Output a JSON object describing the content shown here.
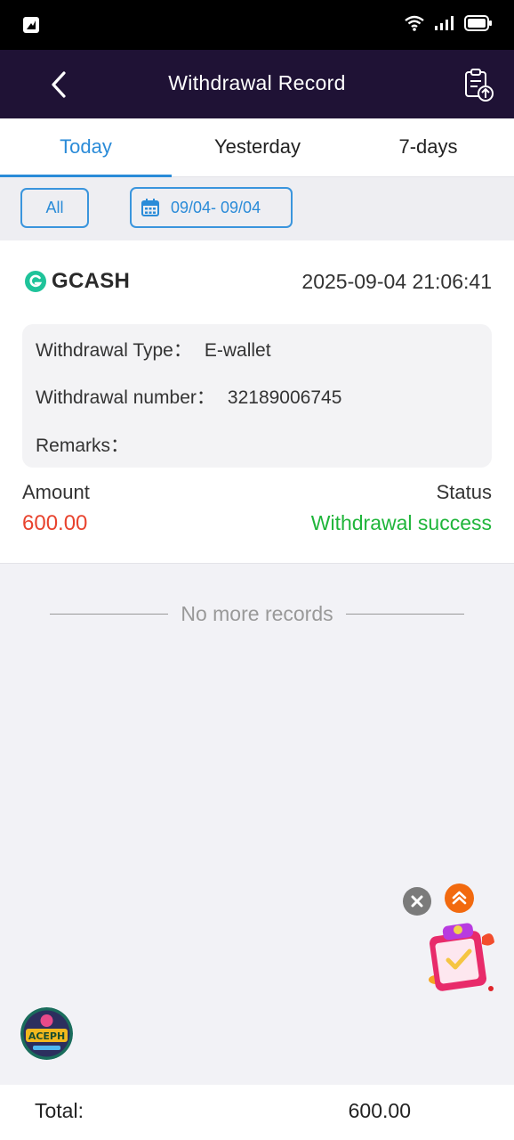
{
  "header": {
    "title": "Withdrawal Record"
  },
  "tabs": [
    {
      "label": "Today",
      "active": true
    },
    {
      "label": "Yesterday",
      "active": false
    },
    {
      "label": "7-days",
      "active": false
    }
  ],
  "filter": {
    "all_label": "All",
    "date_range": "09/04- 09/04"
  },
  "record": {
    "method": "GCASH",
    "datetime": "2025-09-04 21:06:41",
    "type_label": "Withdrawal Type：",
    "type_value": "E-wallet",
    "number_label": "Withdrawal number：",
    "number_value": "32189006745",
    "remarks_label": "Remarks：",
    "amount_label": "Amount",
    "amount_value": "600.00",
    "status_label": "Status",
    "status_value": "Withdrawal success"
  },
  "list_end_text": "No more records",
  "footer": {
    "total_label": "Total:",
    "total_value": "600.00"
  },
  "avatar_text": "ACEPH",
  "colors": {
    "accent": "#2a8bd8",
    "header_bg": "#1f1235",
    "amount": "#e8432e",
    "success": "#1fb53a"
  }
}
